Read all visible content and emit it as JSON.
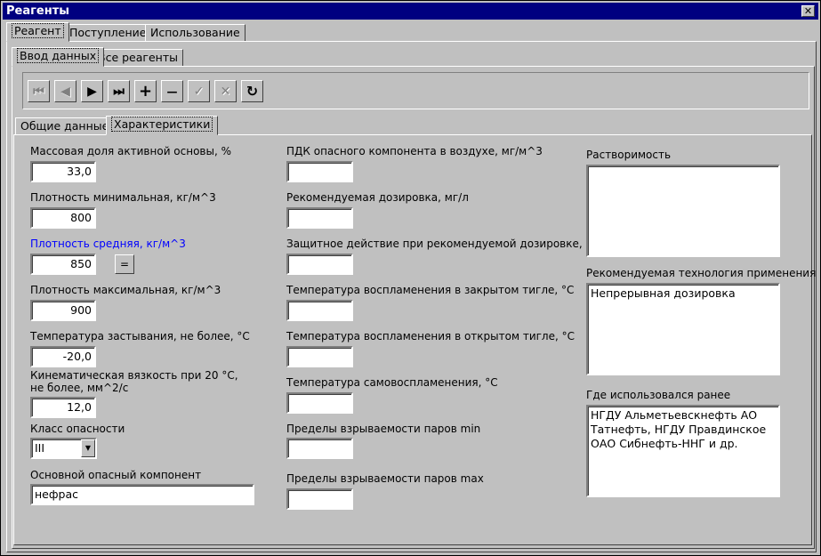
{
  "window": {
    "title": "Реагенты",
    "close_symbol": "✕"
  },
  "tabs_top": [
    "Реагент",
    "Поступление",
    "Использование"
  ],
  "tabs_second": [
    "Ввод данных",
    "Все реагенты"
  ],
  "toolbar": {
    "first": "⏮",
    "prev": "◀",
    "next": "▶",
    "last": "⏭",
    "add": "+",
    "delete": "—",
    "confirm": "✓",
    "cancel": "✕",
    "refresh": "↻"
  },
  "tabs_third": [
    "Общие данные",
    "Характеристики"
  ],
  "col1": {
    "mass_fraction": {
      "label": "Массовая доля активной основы, %",
      "value": "33,0"
    },
    "density_min": {
      "label": "Плотность минимальная, кг/м^3",
      "value": "800"
    },
    "density_avg": {
      "label": "Плотность средняя, кг/м^3",
      "value": "850",
      "button": "="
    },
    "density_max": {
      "label": "Плотность максимальная, кг/м^3",
      "value": "900"
    },
    "pour_point": {
      "label": "Температура застывания, не более, °С",
      "value": "-20,0"
    },
    "viscosity": {
      "label_line1": "Кинематическая вязкость при 20 °С,",
      "label_line2": "не более, мм^2/с",
      "value": "12,0"
    },
    "hazard_class": {
      "label": "Класс опасности",
      "value": "III"
    },
    "main_hazard": {
      "label": "Основной опасный компонент",
      "value": "нефрас"
    }
  },
  "col2": {
    "mac_air": {
      "label": "ПДК опасного компонента в воздухе, мг/м^3",
      "value": ""
    },
    "dosage": {
      "label": "Рекомендуемая дозировка, мг/л",
      "value": ""
    },
    "protection": {
      "label": "Защитное действие при рекомендуемой дозировке, %",
      "value": ""
    },
    "flash_closed": {
      "label": "Температура воспламенения в закрытом тигле, °С",
      "value": ""
    },
    "flash_open": {
      "label": "Температура воспламенения в открытом тигле, °С",
      "value": ""
    },
    "autoignition": {
      "label": "Температура самовоспламенения, °С",
      "value": ""
    },
    "explosive_min": {
      "label": "Пределы взрываемости паров min",
      "value": ""
    },
    "explosive_max": {
      "label": "Пределы взрываемости паров max",
      "value": ""
    }
  },
  "col3": {
    "solubility": {
      "label": "Растворимость",
      "value": ""
    },
    "technology": {
      "label": "Рекомендуемая технология применения",
      "value": "Непрерывная дозировка"
    },
    "used_before": {
      "label": "Где использовался ранее",
      "value": "НГДУ Альметьевскнефть АО\nТатнефть, НГДУ Правдинское\nОАО Сибнефть-ННГ и др."
    }
  },
  "colors": {
    "title_bar": "#000080",
    "face": "#c0c0c0",
    "highlight_label": "#0000ff"
  }
}
